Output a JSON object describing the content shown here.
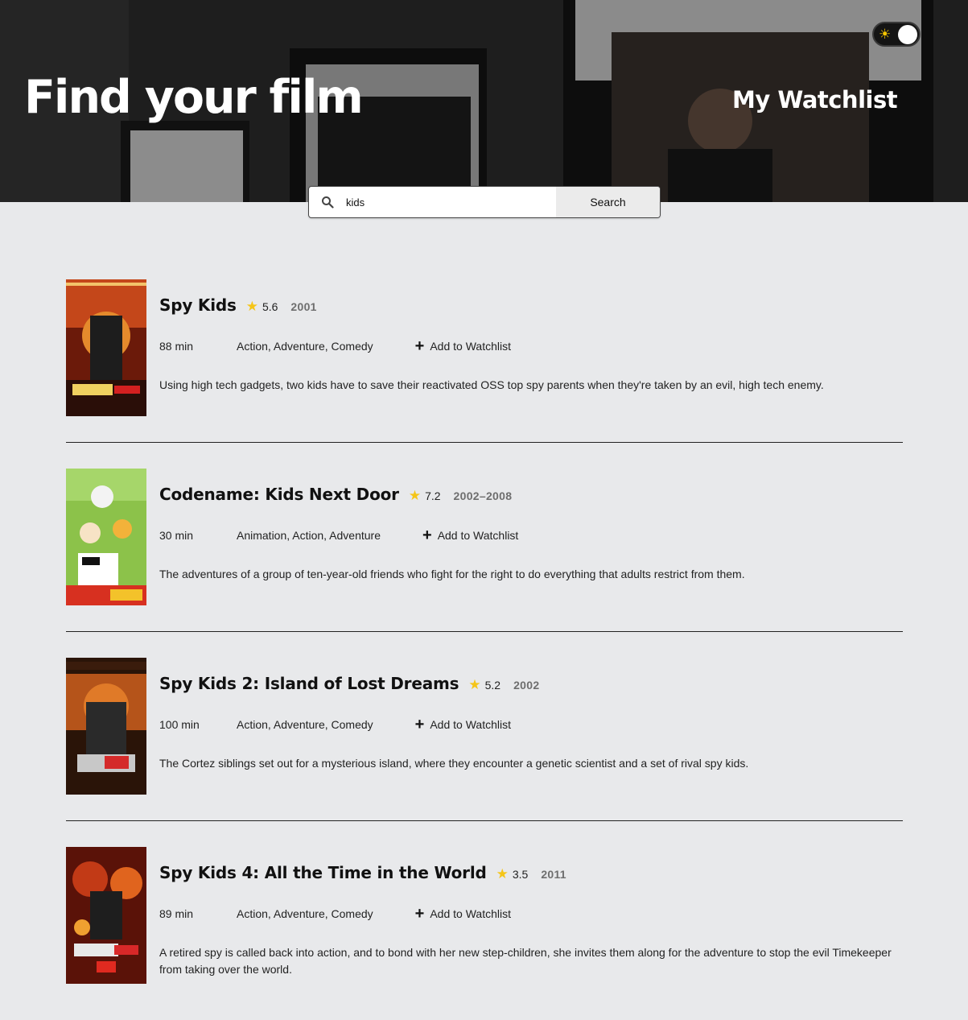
{
  "header": {
    "title": "Find your film",
    "watchlist_link": "My Watchlist",
    "theme_toggle_icon": "sun-icon"
  },
  "search": {
    "value": "kids",
    "button_label": "Search"
  },
  "colors": {
    "background": "#e8e9eb",
    "star": "#f5c518",
    "year": "#6e6e6e"
  },
  "films": [
    {
      "title": "Spy Kids",
      "rating": "5.6",
      "year": "2001",
      "runtime": "88 min",
      "genres": "Action, Adventure, Comedy",
      "add_label": "Add to Watchlist",
      "plot": "Using high tech gadgets, two kids have to save their reactivated OSS top spy parents when they're taken by an evil, high tech enemy."
    },
    {
      "title": "Codename: Kids Next Door",
      "rating": "7.2",
      "year": "2002–2008",
      "runtime": "30 min",
      "genres": "Animation, Action, Adventure",
      "add_label": "Add to Watchlist",
      "plot": "The adventures of a group of ten-year-old friends who fight for the right to do everything that adults restrict from them."
    },
    {
      "title": "Spy Kids 2: Island of Lost Dreams",
      "rating": "5.2",
      "year": "2002",
      "runtime": "100 min",
      "genres": "Action, Adventure, Comedy",
      "add_label": "Add to Watchlist",
      "plot": "The Cortez siblings set out for a mysterious island, where they encounter a genetic scientist and a set of rival spy kids."
    },
    {
      "title": "Spy Kids 4: All the Time in the World",
      "rating": "3.5",
      "year": "2011",
      "runtime": "89 min",
      "genres": "Action, Adventure, Comedy",
      "add_label": "Add to Watchlist",
      "plot": "A retired spy is called back into action, and to bond with her new step-children, she invites them along for the adventure to stop the evil Timekeeper from taking over the world."
    }
  ]
}
